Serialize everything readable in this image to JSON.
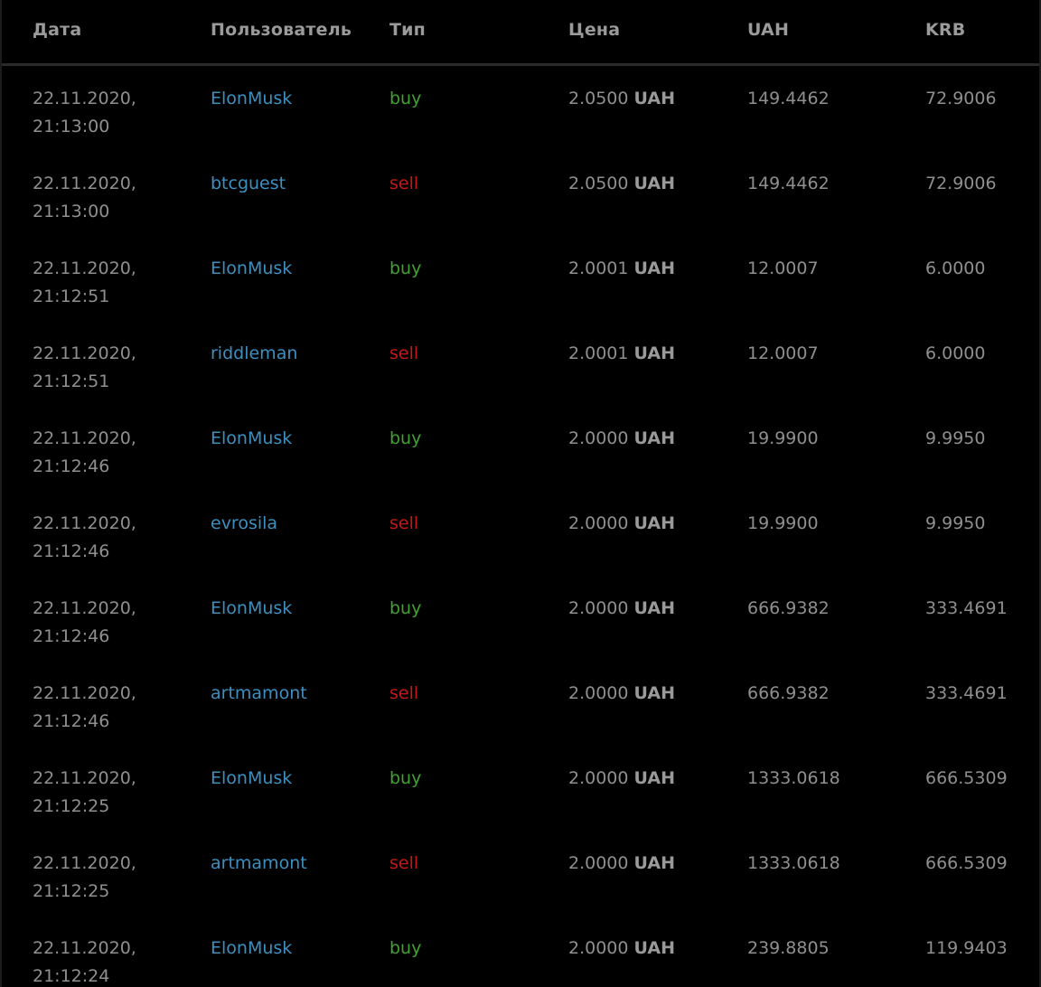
{
  "columns": {
    "date": "Дата",
    "user": "Пользователь",
    "type": "Тип",
    "price": "Цена",
    "uah": "UAH",
    "krb": "KRB"
  },
  "colors": {
    "user_link": "#3d8fc0",
    "buy": "#41a131",
    "sell": "#c21a1a",
    "text": "#8f8f8f",
    "background": "#000000"
  },
  "rows": [
    {
      "date": "22.11.2020,\n21:13:00",
      "user": "ElonMusk",
      "type": "buy",
      "price": "2.0500",
      "currency": "UAH",
      "uah": "149.4462",
      "krb": "72.9006"
    },
    {
      "date": "22.11.2020,\n21:13:00",
      "user": "btcguest",
      "type": "sell",
      "price": "2.0500",
      "currency": "UAH",
      "uah": "149.4462",
      "krb": "72.9006"
    },
    {
      "date": "22.11.2020,\n21:12:51",
      "user": "ElonMusk",
      "type": "buy",
      "price": "2.0001",
      "currency": "UAH",
      "uah": "12.0007",
      "krb": "6.0000"
    },
    {
      "date": "22.11.2020,\n21:12:51",
      "user": "riddleman",
      "type": "sell",
      "price": "2.0001",
      "currency": "UAH",
      "uah": "12.0007",
      "krb": "6.0000"
    },
    {
      "date": "22.11.2020,\n21:12:46",
      "user": "ElonMusk",
      "type": "buy",
      "price": "2.0000",
      "currency": "UAH",
      "uah": "19.9900",
      "krb": "9.9950"
    },
    {
      "date": "22.11.2020,\n21:12:46",
      "user": "evrosila",
      "type": "sell",
      "price": "2.0000",
      "currency": "UAH",
      "uah": "19.9900",
      "krb": "9.9950"
    },
    {
      "date": "22.11.2020,\n21:12:46",
      "user": "ElonMusk",
      "type": "buy",
      "price": "2.0000",
      "currency": "UAH",
      "uah": "666.9382",
      "krb": "333.4691"
    },
    {
      "date": "22.11.2020,\n21:12:46",
      "user": "artmamont",
      "type": "sell",
      "price": "2.0000",
      "currency": "UAH",
      "uah": "666.9382",
      "krb": "333.4691"
    },
    {
      "date": "22.11.2020,\n21:12:25",
      "user": "ElonMusk",
      "type": "buy",
      "price": "2.0000",
      "currency": "UAH",
      "uah": "1333.0618",
      "krb": "666.5309"
    },
    {
      "date": "22.11.2020,\n21:12:25",
      "user": "artmamont",
      "type": "sell",
      "price": "2.0000",
      "currency": "UAH",
      "uah": "1333.0618",
      "krb": "666.5309"
    },
    {
      "date": "22.11.2020,\n21:12:24",
      "user": "ElonMusk",
      "type": "buy",
      "price": "2.0000",
      "currency": "UAH",
      "uah": "239.8805",
      "krb": "119.9403"
    }
  ]
}
